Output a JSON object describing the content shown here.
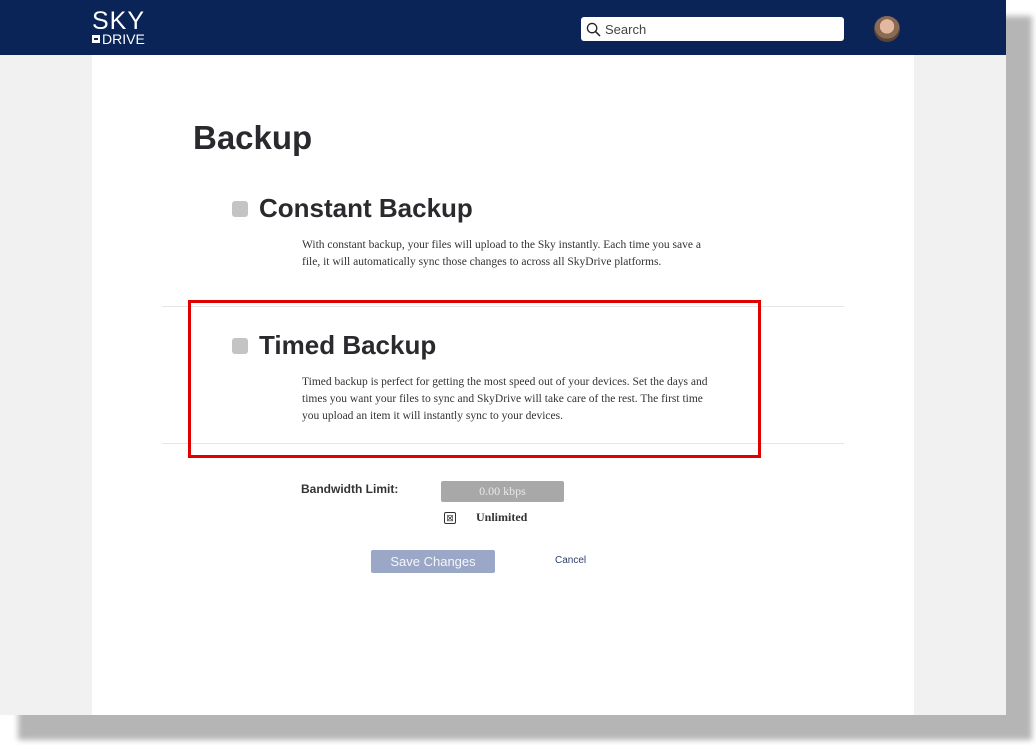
{
  "app": {
    "logo_top": "SKY",
    "logo_bottom": "DRIVE"
  },
  "header": {
    "search_placeholder": "Search",
    "icons": [
      "search-icon",
      "user-avatar"
    ]
  },
  "page": {
    "title": "Backup"
  },
  "options": [
    {
      "title": "Constant Backup",
      "description": "With constant backup, your files will upload to the Sky instantly. Each time you save a file, it will automatically sync those changes to across all SkyDrive platforms."
    },
    {
      "title": "Timed Backup",
      "description": "Timed backup is perfect for getting the most speed out of your devices. Set the days and times you want your files to sync and SkyDrive will take care of the rest. The first time you upload an item it will instantly sync to your devices."
    }
  ],
  "bandwidth": {
    "label": "Bandwidth Limit:",
    "value": "0.00 kbps",
    "unlimited_mark": "⊠",
    "unlimited_label": "Unlimited"
  },
  "actions": {
    "save_label": "Save Changes",
    "cancel_label": "Cancel"
  },
  "colors": {
    "header_bg": "#0a2458",
    "highlight": "#e00000",
    "save_button": "#9aa7c7"
  }
}
